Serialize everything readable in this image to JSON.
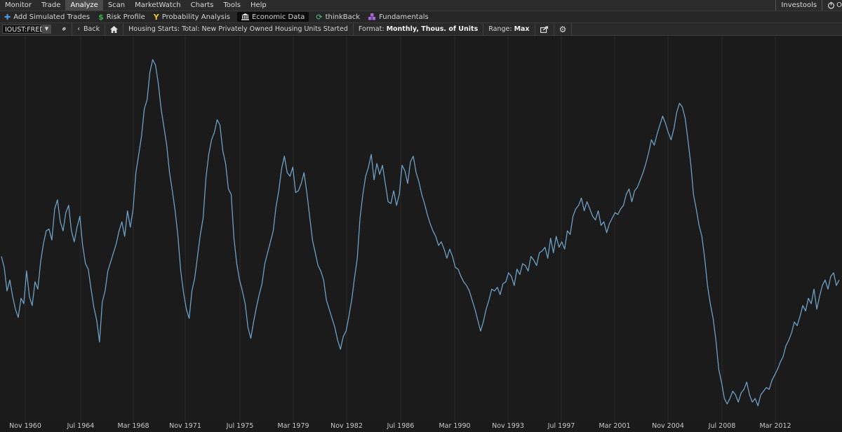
{
  "menubar": {
    "items": [
      "Monitor",
      "Trade",
      "Analyze",
      "Scan",
      "MarketWatch",
      "Charts",
      "Tools",
      "Help"
    ],
    "active": "Analyze",
    "right_label": "Investools",
    "right_trunc": "O"
  },
  "toolbar": {
    "items": [
      {
        "label": "Add Simulated Trades",
        "icon": "plus-icon"
      },
      {
        "label": "Risk Profile",
        "icon": "dollar-icon"
      },
      {
        "label": "Probability Analysis",
        "icon": "fork-icon"
      },
      {
        "label": "Economic Data",
        "icon": "bank-icon",
        "active": true
      },
      {
        "label": "thinkBack",
        "icon": "refresh-icon"
      },
      {
        "label": "Fundamentals",
        "icon": "blocks-icon"
      }
    ]
  },
  "chartbar": {
    "symbol": "IOUST:FRED",
    "back_label": "Back",
    "series_title": "Housing Starts: Total: New Privately Owned Housing Units Started",
    "format_label": "Format:",
    "format_value": "Monthly, Thous. of Units",
    "range_label": "Range:",
    "range_value": "Max"
  },
  "colors": {
    "line": "#6e9fc4",
    "background": "#1b1b1b",
    "grid": "#2a2a2a"
  },
  "chart_data": {
    "type": "line",
    "title": "",
    "xlabel": "",
    "ylabel": "",
    "grid": true,
    "x_ticks": [
      "Nov 1960",
      "Jul 1964",
      "Mar 1968",
      "Nov 1971",
      "Jul 1975",
      "Mar 1979",
      "Nov 1982",
      "Jul 1986",
      "Mar 1990",
      "Nov 1993",
      "Jul 1997",
      "Mar 2001",
      "Nov 2004",
      "Jul 2008",
      "Mar 2012"
    ],
    "series": [
      {
        "values": [
          1340,
          1280,
          1150,
          1210,
          1120,
          1050,
          1005,
          1110,
          1080,
          1260,
          1120,
          1070,
          1200,
          1160,
          1310,
          1410,
          1480,
          1490,
          1430,
          1600,
          1650,
          1530,
          1480,
          1580,
          1620,
          1480,
          1420,
          1500,
          1560,
          1400,
          1300,
          1270,
          1160,
          1060,
          990,
          870,
          1090,
          1150,
          1260,
          1310,
          1360,
          1410,
          1480,
          1530,
          1450,
          1590,
          1500,
          1600,
          1800,
          1900,
          2000,
          2150,
          2200,
          2350,
          2420,
          2390,
          2290,
          2150,
          2050,
          1950,
          1800,
          1700,
          1590,
          1450,
          1260,
          1140,
          1050,
          1000,
          1150,
          1220,
          1340,
          1460,
          1550,
          1770,
          1900,
          1980,
          2020,
          2090,
          2060,
          1920,
          1850,
          1710,
          1680,
          1440,
          1300,
          1210,
          1150,
          1080,
          950,
          890,
          980,
          1060,
          1130,
          1190,
          1300,
          1360,
          1420,
          1480,
          1610,
          1700,
          1820,
          1890,
          1800,
          1780,
          1830,
          1690,
          1700,
          1740,
          1800,
          1690,
          1560,
          1430,
          1360,
          1290,
          1260,
          1210,
          1100,
          1050,
          1000,
          950,
          880,
          830,
          900,
          930,
          1010,
          1100,
          1220,
          1330,
          1550,
          1680,
          1780,
          1830,
          1900,
          1760,
          1850,
          1790,
          1840,
          1740,
          1640,
          1630,
          1700,
          1620,
          1680,
          1840,
          1810,
          1740,
          1860,
          1890,
          1800,
          1750,
          1680,
          1630,
          1570,
          1520,
          1480,
          1450,
          1400,
          1420,
          1380,
          1330,
          1380,
          1340,
          1280,
          1270,
          1230,
          1200,
          1180,
          1150,
          1100,
          1050,
          990,
          930,
          980,
          1050,
          1100,
          1160,
          1150,
          1170,
          1130,
          1190,
          1200,
          1250,
          1230,
          1180,
          1270,
          1240,
          1300,
          1290,
          1260,
          1340,
          1320,
          1290,
          1360,
          1370,
          1390,
          1330,
          1440,
          1360,
          1450,
          1390,
          1420,
          1380,
          1480,
          1460,
          1560,
          1600,
          1620,
          1660,
          1590,
          1640,
          1600,
          1560,
          1540,
          1590,
          1510,
          1530,
          1470,
          1520,
          1550,
          1580,
          1570,
          1600,
          1620,
          1680,
          1710,
          1640,
          1700,
          1720,
          1760,
          1800,
          1850,
          1910,
          1980,
          1950,
          2010,
          2060,
          2110,
          2070,
          2020,
          1980,
          2040,
          2130,
          2180,
          2160,
          2100,
          1980,
          1850,
          1680,
          1600,
          1510,
          1450,
          1330,
          1180,
          1080,
          1000,
          880,
          720,
          650,
          560,
          530,
          560,
          600,
          580,
          540,
          590,
          610,
          650,
          580,
          540,
          560,
          520,
          580,
          600,
          620,
          610,
          660,
          690,
          720,
          760,
          790,
          850,
          880,
          920,
          980,
          960,
          1010,
          1070,
          1040,
          1110,
          1080,
          1160,
          1050,
          1120,
          1180,
          1210,
          1160,
          1230,
          1250,
          1180,
          1210
        ]
      }
    ]
  }
}
